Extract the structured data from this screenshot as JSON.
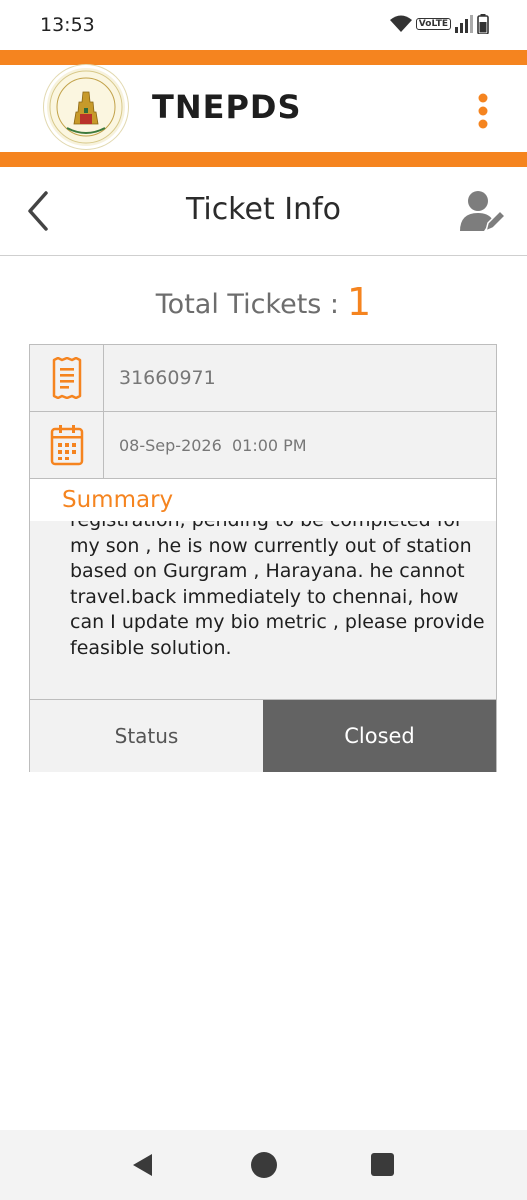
{
  "status_bar": {
    "time": "13:53",
    "volte": "VoLTE"
  },
  "app": {
    "title": "TNEPDS"
  },
  "page": {
    "title": "Ticket Info"
  },
  "totals": {
    "label": "Total Tickets :",
    "count": "1"
  },
  "ticket": {
    "number": "31660971",
    "datetime": "08-Sep-2026  01:00 PM",
    "summary_label": "Summary",
    "summary_text": "registration, pending to be completed for my son , he is now currently out of station based on Gurgram , Harayana. he cannot travel.back immediately to chennai, how can I update my bio metric , please provide feasible solution.",
    "status_label": "Status",
    "status_value": "Closed"
  },
  "colors": {
    "accent": "#f5841f",
    "status_bg": "#636363"
  },
  "icons": {
    "receipt": "receipt-icon",
    "calendar": "calendar-icon",
    "back": "chevron-left-icon",
    "profile": "user-edit-icon",
    "menu": "more-vert-icon"
  }
}
